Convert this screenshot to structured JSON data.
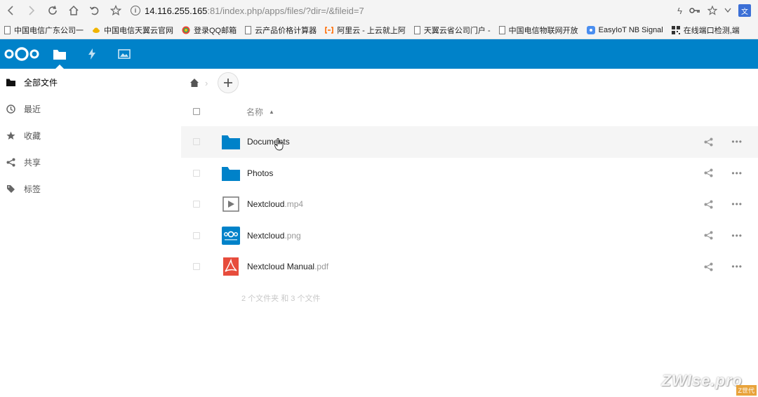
{
  "browser": {
    "url_host": "14.116.255.165",
    "url_path": ":81/index.php/apps/files/?dir=/&fileid=7",
    "bookmarks": [
      "中国电信广东公司一",
      "中国电信天翼云官网",
      "登录QQ邮箱",
      "云产品价格计算器",
      "阿里云 - 上云就上阿",
      "天翼云省公司门户 -",
      "中国电信物联网开放",
      "EasyIoT NB Signal",
      "在线端口检测,端"
    ]
  },
  "sidebar": {
    "items": [
      {
        "label": "全部文件",
        "icon": "folder-icon"
      },
      {
        "label": "最近",
        "icon": "clock-icon"
      },
      {
        "label": "收藏",
        "icon": "star-icon"
      },
      {
        "label": "共享",
        "icon": "share-icon"
      },
      {
        "label": "标签",
        "icon": "tag-icon"
      }
    ]
  },
  "main": {
    "name_header": "名称",
    "files": [
      {
        "name": "Documents",
        "ext": "",
        "icon": "folder-icon"
      },
      {
        "name": "Photos",
        "ext": "",
        "icon": "folder-icon"
      },
      {
        "name": "Nextcloud",
        "ext": ".mp4",
        "icon": "video-icon"
      },
      {
        "name": "Nextcloud",
        "ext": ".png",
        "icon": "image-icon"
      },
      {
        "name": "Nextcloud Manual",
        "ext": ".pdf",
        "icon": "pdf-icon"
      }
    ],
    "summary": "2 个文件夹 和 3 个文件"
  },
  "watermark": "ZWIse.pro",
  "watermark_badge": "Z世代",
  "colors": {
    "header_bg": "#0082c9",
    "folder": "#0082c9",
    "pdf": "#e74c3c"
  }
}
